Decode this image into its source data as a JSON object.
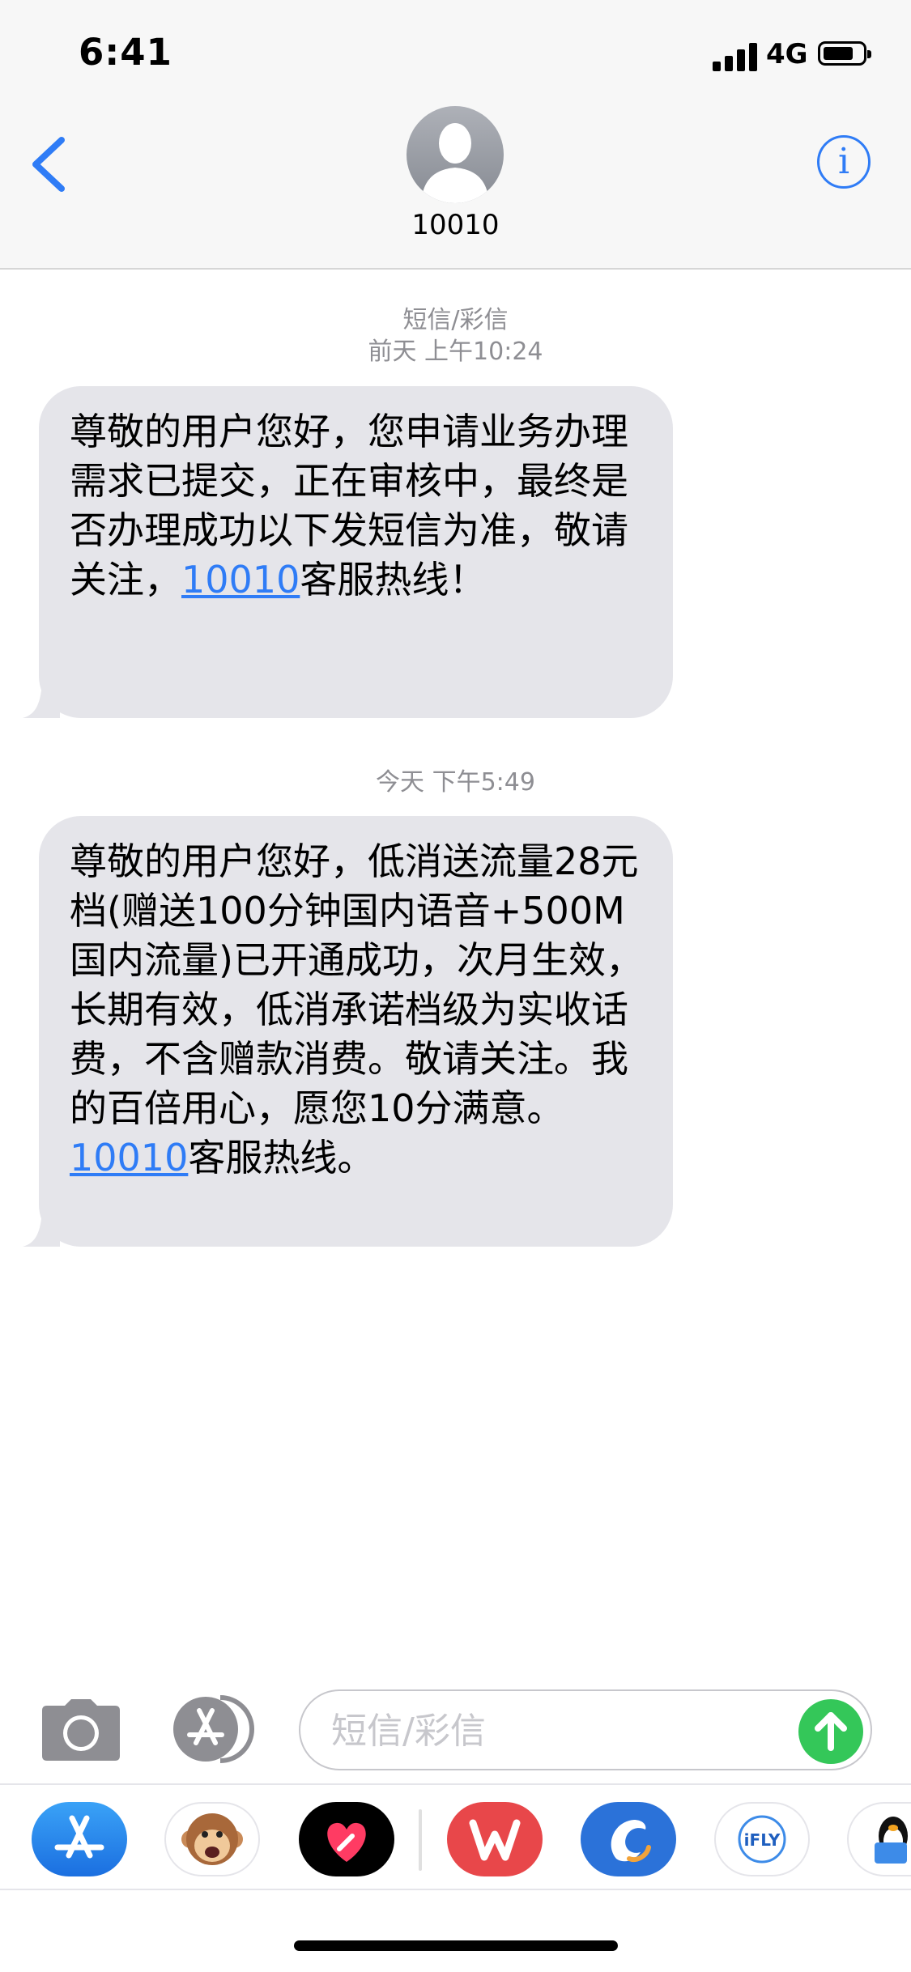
{
  "status_bar": {
    "time": "6:41",
    "network": "4G",
    "battery_level": 0.8
  },
  "header": {
    "contact_name": "10010"
  },
  "messages": [
    {
      "meta_type": "短信/彩信",
      "meta_time": "前天 上午10:24",
      "text_before": "尊敬的用户您好，您申请业务办理需求已提交，正在审核中，最终是否办理成功以下发短信为准，敬请关注，",
      "link": "10010",
      "text_after": "客服热线！"
    },
    {
      "meta_time": "今天 下午5:49",
      "text_before": "尊敬的用户您好，低消送流量28元档(赠送100分钟国内语音+500M国内流量)已开通成功，次月生效，长期有效，低消承诺档级为实收话费，不含赠款消费。敬请关注。我的百倍用心，愿您10分满意。",
      "link": "10010",
      "text_after": "客服热线。"
    }
  ],
  "input_bar": {
    "placeholder": "短信/彩信"
  },
  "app_strip": {
    "apps": [
      "app-store-icon",
      "animoji-monkey-icon",
      "digital-touch-heart-icon",
      "wps-office-icon",
      "dolphin-app-icon",
      "ifly-icon",
      "qq-penguin-icon"
    ],
    "ifly_label": "iFLY"
  },
  "colors": {
    "accent": "#2f7cf6",
    "bubble": "#e5e5ea",
    "send": "#34c759",
    "meta": "#8e8e93"
  }
}
